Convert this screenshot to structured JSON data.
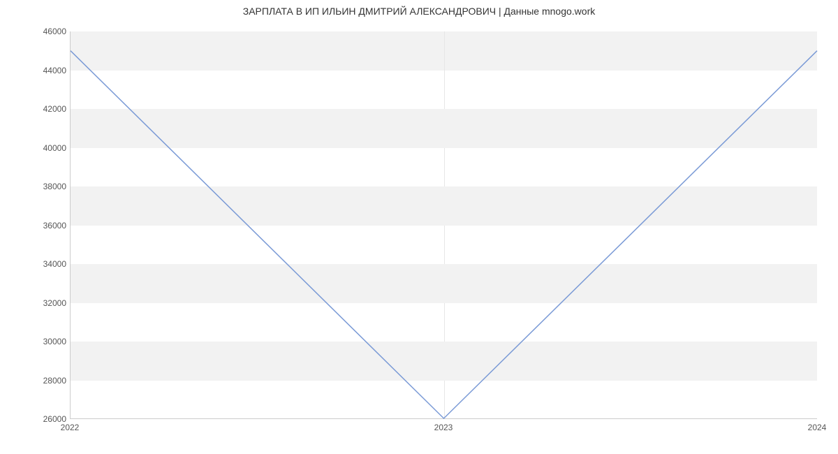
{
  "chart_data": {
    "type": "line",
    "title": "ЗАРПЛАТА В ИП ИЛЬИН ДМИТРИЙ АЛЕКСАНДРОВИЧ | Данные mnogo.work",
    "xlabel": "",
    "ylabel": "",
    "x_ticks": [
      "2022",
      "2023",
      "2024"
    ],
    "y_ticks": [
      26000,
      28000,
      30000,
      32000,
      34000,
      36000,
      38000,
      40000,
      42000,
      44000,
      46000
    ],
    "ylim": [
      26000,
      46000
    ],
    "x": [
      "2022",
      "2023",
      "2024"
    ],
    "values": [
      45000,
      26000,
      45000
    ],
    "grid": {
      "horizontal_bands": true,
      "vertical": true
    },
    "colors": {
      "line": "#7a9ad6",
      "band": "#f2f2f2"
    }
  }
}
